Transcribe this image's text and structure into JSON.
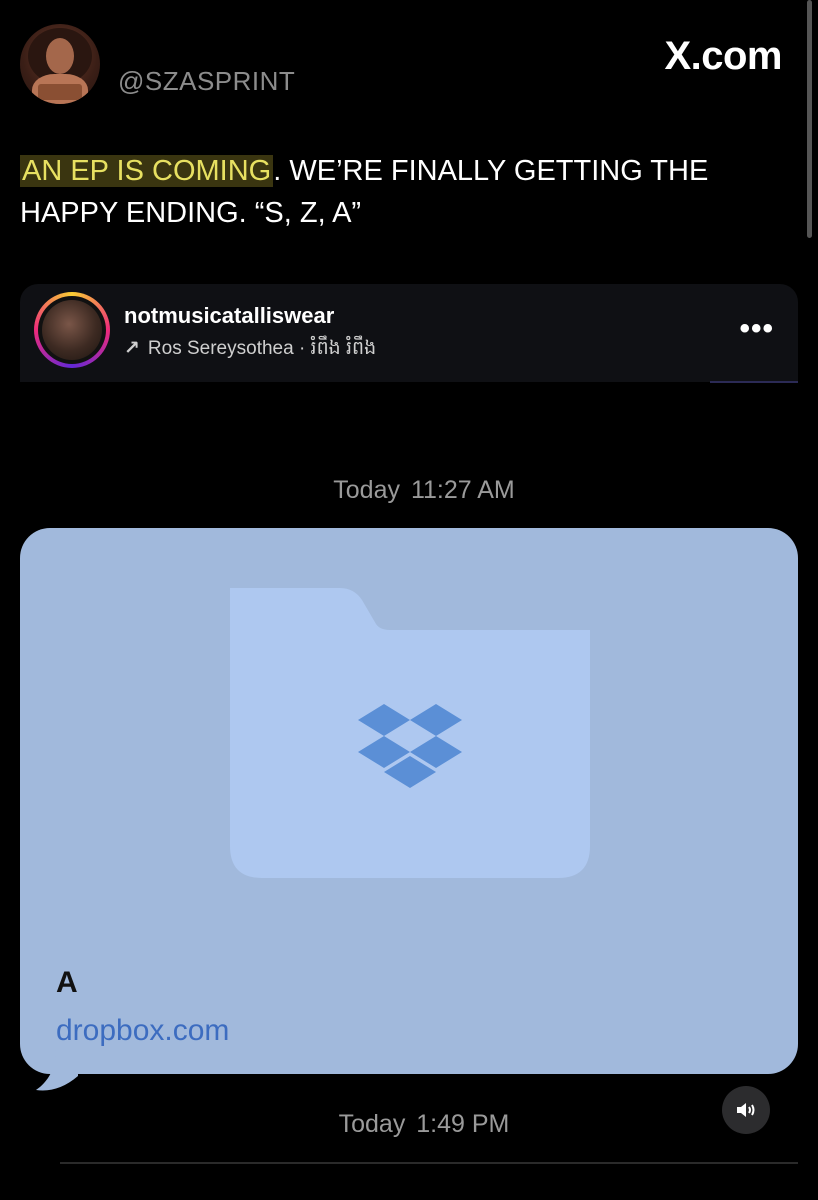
{
  "post": {
    "handle": "@SZASPRINT",
    "brand": "X.com",
    "text_highlight": "AN EP IS COMING",
    "text_rest": ". WE’RE FINALLY GETTING THE HAPPY ENDING. “S, Z, A”"
  },
  "instagram": {
    "username": "notmusicatalliswear",
    "audio": "Ros Sereysothea · រំពឹង រំពឹង",
    "arrow": "↗",
    "more": "•••"
  },
  "chat": {
    "time1_label": "Today",
    "time1_value": "11:27 AM",
    "file_title": "A",
    "file_domain": "dropbox.com",
    "time2_label": "Today",
    "time2_value": "1:49 PM"
  },
  "icons": {
    "avatar": "avatar-image",
    "folder": "folder-icon",
    "dropbox": "dropbox-icon",
    "sound": "speaker-icon"
  },
  "colors": {
    "background": "#000000",
    "highlight_bg": "#3a3510",
    "highlight_text": "#e7e061",
    "bubble": "#a1b9dc",
    "folder": "#aec8f0",
    "dropbox_blue": "#5b8fd6",
    "link": "#3c6cc0"
  }
}
